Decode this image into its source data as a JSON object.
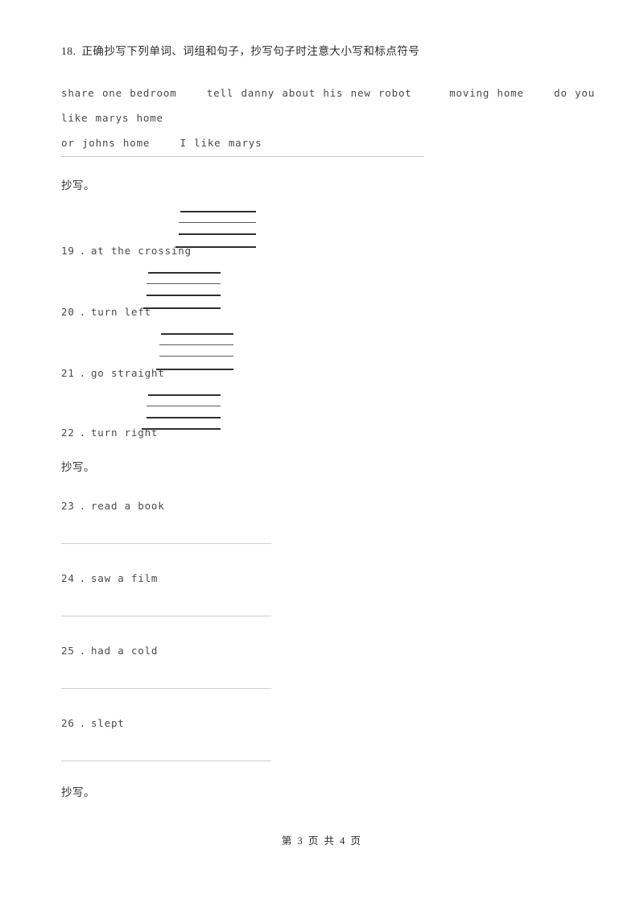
{
  "question_18": {
    "number": "18",
    "separator": ".",
    "prompt": "正确抄写下列单词、词组和句子，抄写句子时注意大小写和标点符号",
    "phrases_line1": "share one bedroom    tell danny about his new robot     moving home    do you like marys home",
    "phrases_line2": "or johns home    I like marys"
  },
  "copy_labels": {
    "first": "抄写。",
    "second": "抄写。",
    "third": "抄写。"
  },
  "items_with_guides": [
    {
      "number": "19",
      "separator": ".",
      "text": "at the crossing"
    },
    {
      "number": "20",
      "separator": ".",
      "text": "turn left"
    },
    {
      "number": "21",
      "separator": ".",
      "text": "go straight"
    },
    {
      "number": "22",
      "separator": ".",
      "text": "turn right"
    }
  ],
  "items_with_rules": [
    {
      "number": "23",
      "separator": ".",
      "text": "read a book"
    },
    {
      "number": "24",
      "separator": ".",
      "text": "saw a film"
    },
    {
      "number": "25",
      "separator": ".",
      "text": "had a cold"
    },
    {
      "number": "26",
      "separator": ".",
      "text": "slept"
    }
  ],
  "footer": {
    "text": "第 3 页 共 4 页",
    "current_page": "3",
    "total_pages": "4"
  },
  "colors": {
    "page_background": "#ffffff",
    "body_text": "#4a4a4a",
    "heading_text": "#2b2b2b",
    "rule_light": "#c9c9c9",
    "guide_line": "#2f2f2f"
  }
}
